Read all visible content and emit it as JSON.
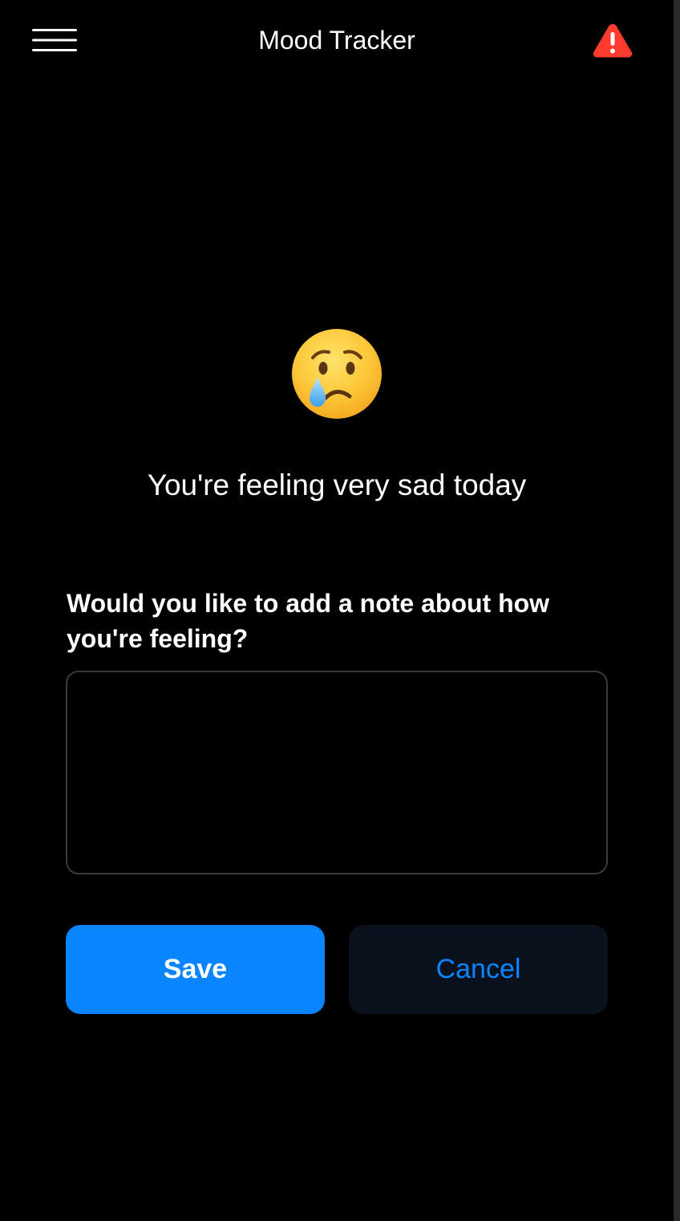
{
  "header": {
    "title": "Mood Tracker",
    "menu_icon": "hamburger-menu-icon",
    "alert_icon": "warning-triangle-icon"
  },
  "mood": {
    "emoji": "😢",
    "message": "You're feeling very sad today"
  },
  "note": {
    "prompt": "Would you like to add a note about how you're feeling?",
    "value": "",
    "placeholder": ""
  },
  "actions": {
    "save_label": "Save",
    "cancel_label": "Cancel"
  },
  "colors": {
    "background": "#000000",
    "accent": "#0a84ff",
    "alert": "#ff3b30",
    "cancel_background": "#08111c",
    "input_border": "#3a3a3c"
  }
}
